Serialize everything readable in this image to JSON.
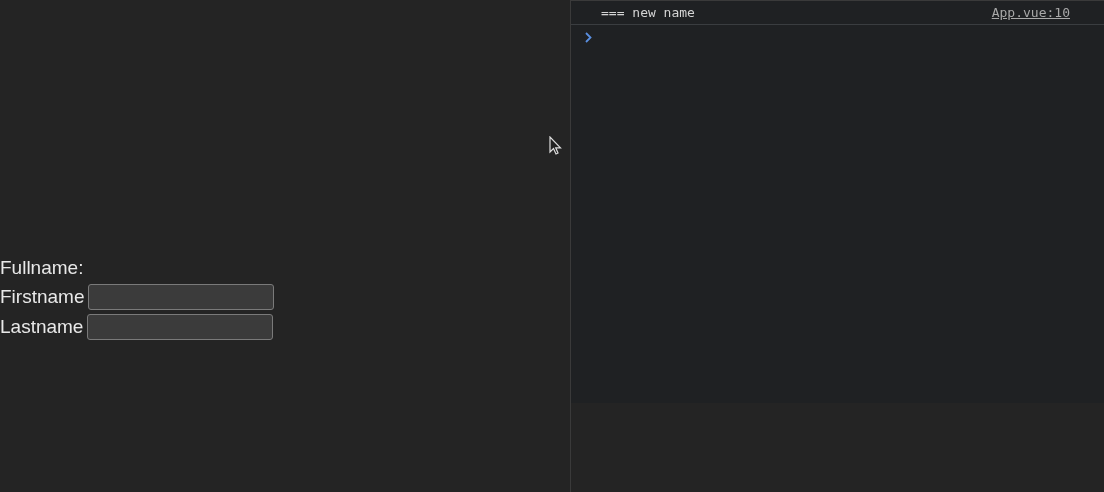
{
  "form": {
    "fullname_label": "Fullname:",
    "fields": [
      {
        "label": "Firstname"
      },
      {
        "label": "Lastname"
      }
    ]
  },
  "console": {
    "messages": [
      {
        "text": "=== new name",
        "source": "App.vue:10"
      }
    ]
  }
}
